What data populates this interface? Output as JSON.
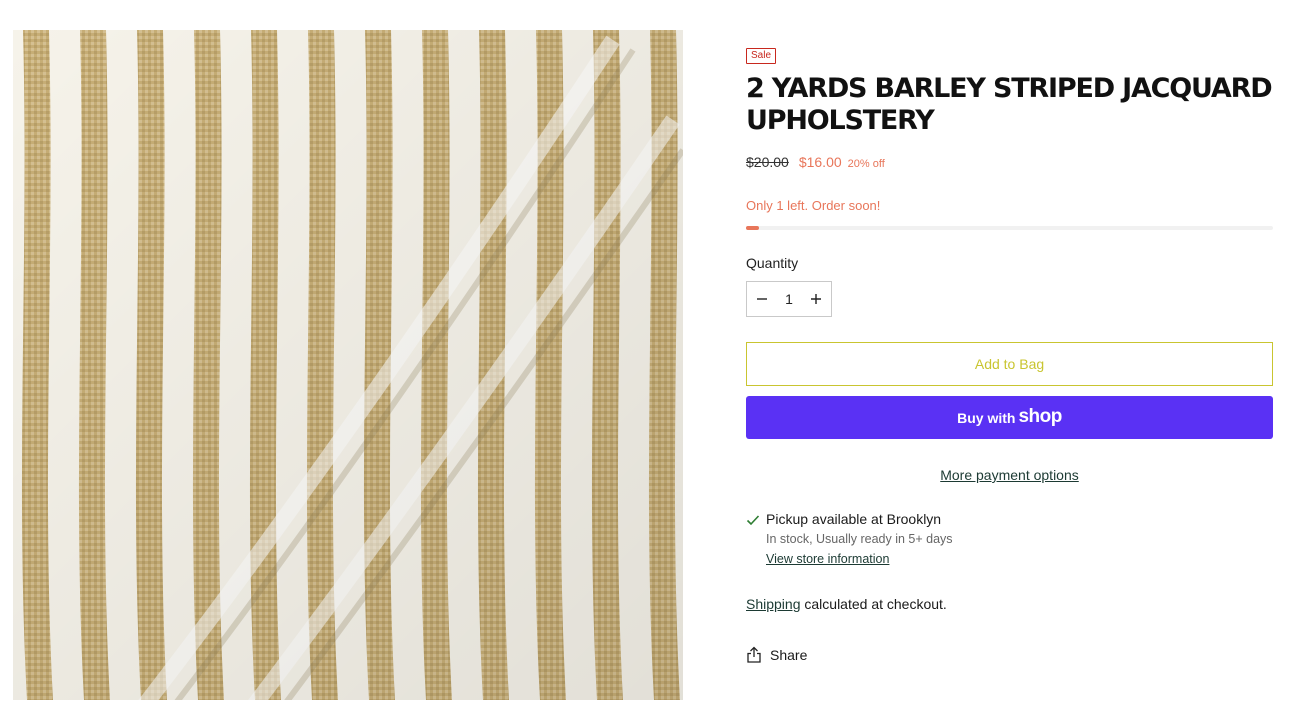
{
  "product": {
    "badge": "Sale",
    "title": "2 YARDS BARLEY STRIPED JACQUARD UPHOLSTERY",
    "image_icon": "striped-fabric-image",
    "price": {
      "compare_at": "$20.00",
      "current": "$16.00",
      "discount": "20% off"
    },
    "stock": {
      "message": "Only 1 left. Order soon!",
      "level_fraction": 0.025
    }
  },
  "quantity": {
    "label": "Quantity",
    "value": "1",
    "decrease_icon": "minus-icon",
    "increase_icon": "plus-icon"
  },
  "actions": {
    "add_to_bag": "Add to Bag",
    "buy_with": "Buy with",
    "shop_brand": "shop",
    "more_payment": "More payment options"
  },
  "pickup": {
    "icon": "check-icon",
    "title": "Pickup available at Brooklyn",
    "subtitle": "In stock, Usually ready in 5+ days",
    "link": "View store information"
  },
  "shipping": {
    "link": "Shipping",
    "text": " calculated at checkout."
  },
  "share": {
    "icon": "share-icon",
    "label": "Share"
  },
  "colors": {
    "sale_red": "#c8281e",
    "price_coral": "#e8765a",
    "add_to_bag_yellow": "#c9c530",
    "shop_pay_purple": "#5a31f4",
    "fabric_tan": "#c9b27a",
    "fabric_cream": "#f6f3ea"
  }
}
